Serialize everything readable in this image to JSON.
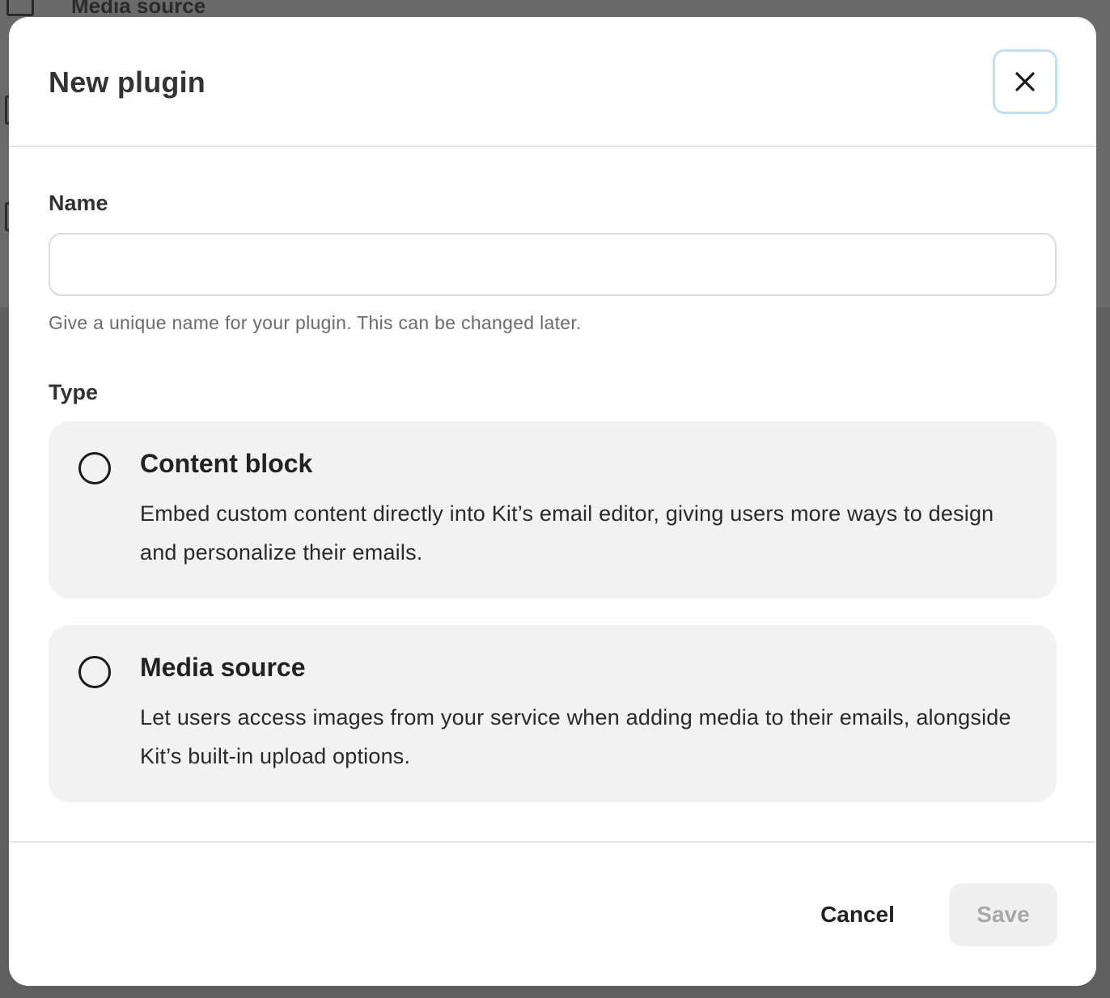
{
  "background": {
    "row_label": "Media source"
  },
  "modal": {
    "title": "New plugin",
    "close_icon": "close-icon"
  },
  "form": {
    "name": {
      "label": "Name",
      "value": "",
      "placeholder": "",
      "help": "Give a unique name for your plugin. This can be changed later."
    },
    "type": {
      "label": "Type",
      "options": [
        {
          "title": "Content block",
          "description": "Embed custom content directly into Kit’s email editor, giving users more ways to design and personalize their emails.",
          "selected": false
        },
        {
          "title": "Media source",
          "description": "Let users access images from your service when adding media to their emails, alongside Kit’s built-in upload options.",
          "selected": false
        }
      ]
    }
  },
  "footer": {
    "cancel_label": "Cancel",
    "save_label": "Save"
  },
  "colors": {
    "focus_ring": "#bfe0f5",
    "card_background": "#f2f2f2",
    "disabled_text": "#a8a8a8"
  }
}
